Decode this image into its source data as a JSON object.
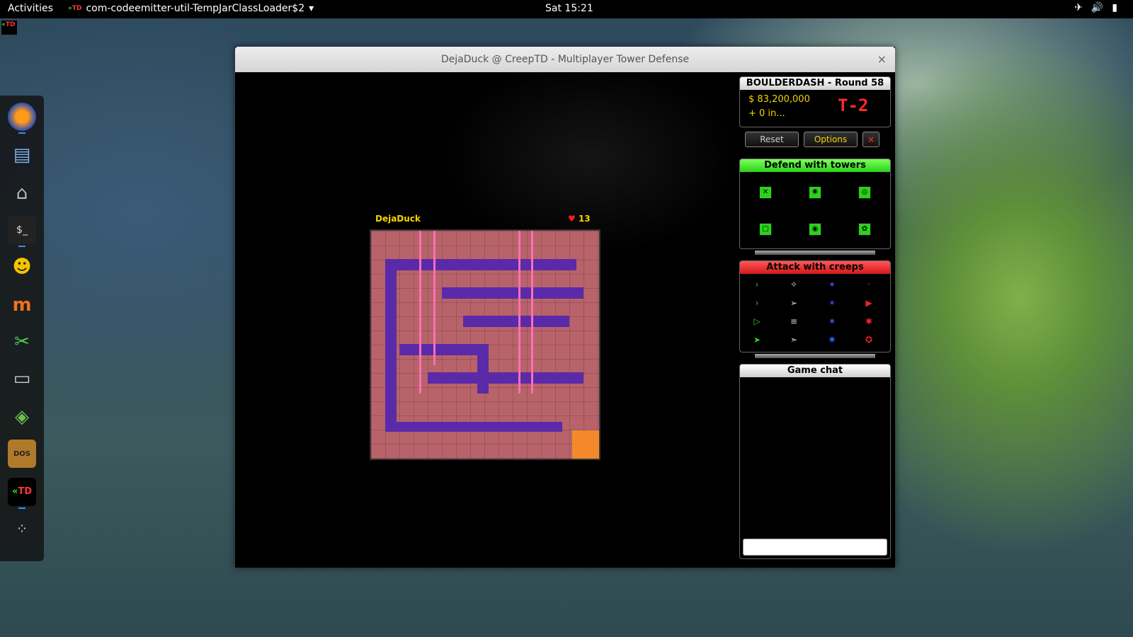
{
  "topbar": {
    "activities": "Activities",
    "app_name": "com-codeemitter-util-TempJarClassLoader$2",
    "app_menu_arrow": "▾",
    "clock": "Sat 15:21",
    "icons": [
      "airplane-icon",
      "volume-icon",
      "battery-icon"
    ]
  },
  "dock": {
    "items": [
      "firefox-icon",
      "document-icon",
      "files-icon",
      "terminal-icon",
      "pidgin-icon",
      "mumble-icon",
      "scissors-icon",
      "gamepad-icon",
      "stack-icon",
      "dosbox-icon",
      "creeptd-icon",
      "app-grid-icon"
    ]
  },
  "window": {
    "title": "DejaDuck @ CreepTD - Multiplayer Tower Defense",
    "close": "×"
  },
  "game": {
    "player_name": "DejaDuck",
    "lives": "13",
    "lives_icon": "heart-icon"
  },
  "status": {
    "map_round": "BOULDERDASH - Round 58",
    "money": "$ 83,200,000",
    "income": "+ 0 in...",
    "timer": "T-2"
  },
  "buttons": {
    "reset": "Reset",
    "options": "Options",
    "close": "×"
  },
  "towers": {
    "header": "Defend with towers",
    "items": [
      "tower-1-icon",
      "tower-2-icon",
      "tower-3-icon",
      "tower-4-icon",
      "tower-5-icon",
      "tower-6-icon"
    ]
  },
  "creeps": {
    "header": "Attack with creeps",
    "items": [
      "creep-icon"
    ]
  },
  "chat": {
    "header": "Game chat",
    "input_value": ""
  },
  "colors": {
    "accent_yellow": "#f5d400",
    "timer_red": "#ff2a2a",
    "tower_green": "#2bd21a",
    "creep_red": "#d41818"
  }
}
